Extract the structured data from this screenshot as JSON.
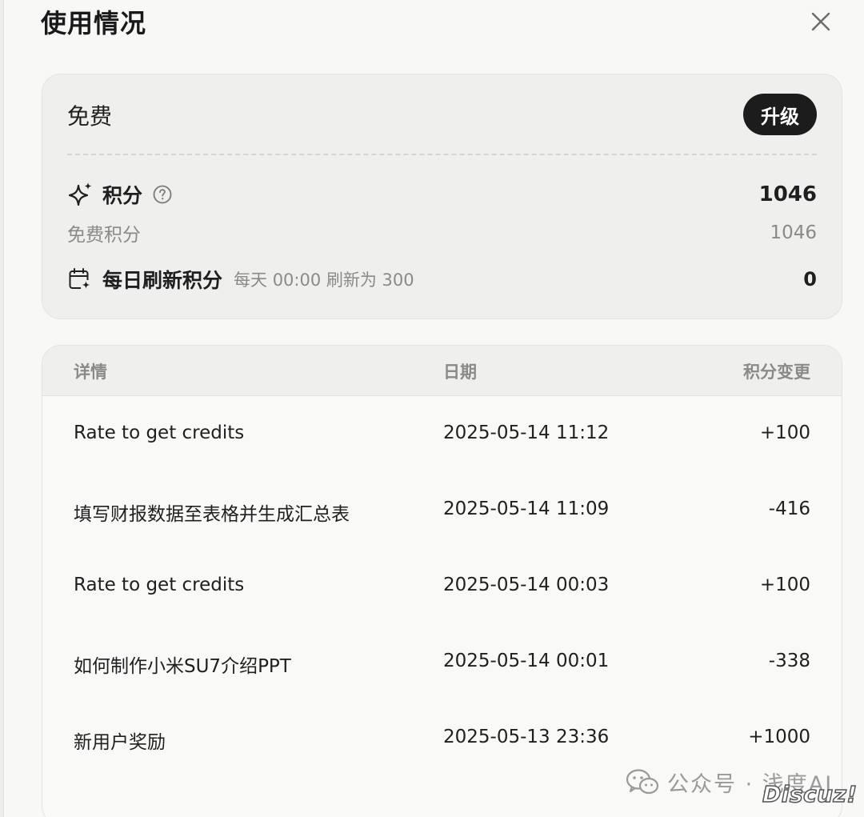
{
  "header": {
    "title": "使用情况"
  },
  "plan": {
    "name": "免费",
    "upgrade_label": "升级",
    "credits": {
      "label": "积分",
      "value": "1046"
    },
    "free_credits": {
      "label": "免费积分",
      "value": "1046"
    },
    "daily_refresh": {
      "label": "每日刷新积分",
      "description": "每天 00:00 刷新为 300",
      "value": "0"
    }
  },
  "history": {
    "columns": [
      "详情",
      "日期",
      "积分变更"
    ],
    "rows": [
      {
        "detail": "Rate to get credits",
        "date": "2025-05-14 11:12",
        "change": "+100"
      },
      {
        "detail": "填写财报数据至表格并生成汇总表",
        "date": "2025-05-14 11:09",
        "change": "-416"
      },
      {
        "detail": "Rate to get credits",
        "date": "2025-05-14 00:03",
        "change": "+100"
      },
      {
        "detail": "如何制作小米SU7介绍PPT",
        "date": "2025-05-14 00:01",
        "change": "-338"
      },
      {
        "detail": "新用户奖励",
        "date": "2025-05-13 23:36",
        "change": "+1000"
      }
    ]
  },
  "watermark": {
    "text": "公众号 · 浅度AI",
    "forum_logo": "Discuz!"
  },
  "icons": {
    "close": "close-icon",
    "sparkle": "sparkle-icon",
    "help": "help-icon",
    "calendar": "calendar-refresh-icon",
    "wechat": "wechat-icon"
  },
  "colors": {
    "upgrade_button_bg": "#1c1c1c",
    "card_bg": "#efefed",
    "muted_text": "#8a8a87"
  }
}
